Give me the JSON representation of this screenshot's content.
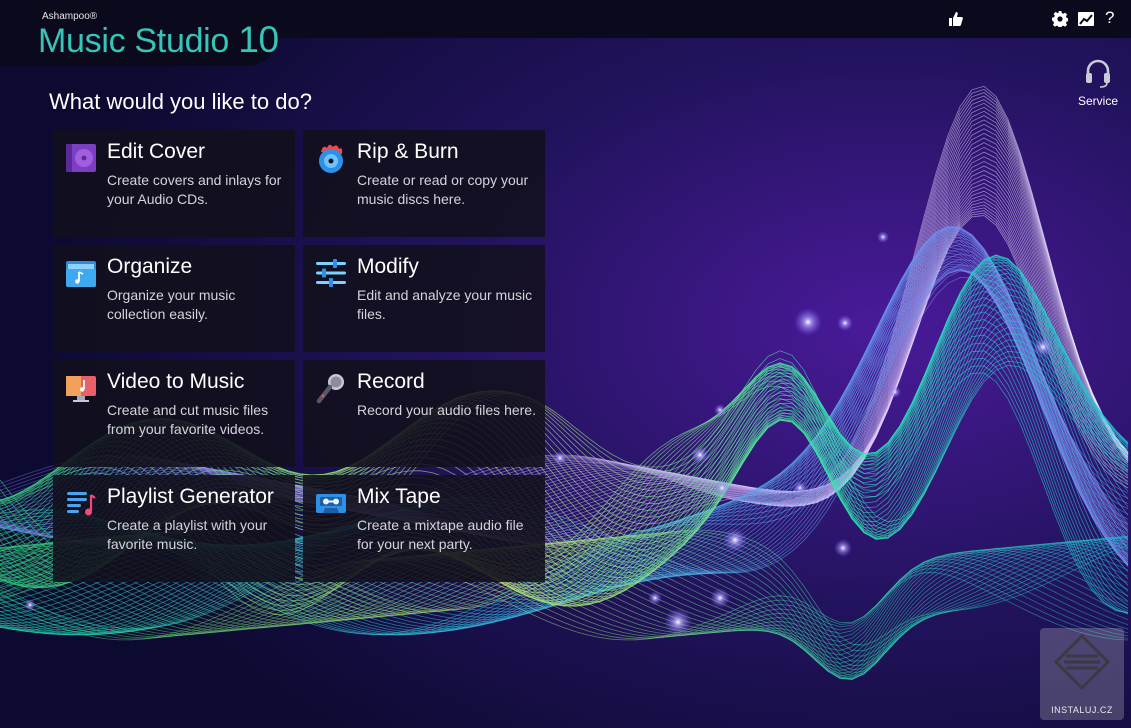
{
  "app": {
    "vendor": "Ashampoo®",
    "name": "Music Studio",
    "version": "10"
  },
  "toolbar": {
    "like_icon": "thumbs-up-icon",
    "settings_icon": "gear-icon",
    "chart_icon": "chart-icon",
    "help_label": "?"
  },
  "service": {
    "label": "Service",
    "icon": "headset-icon"
  },
  "headline": "What would you like to do?",
  "tiles": [
    {
      "title": "Edit Cover",
      "desc": "Create covers and inlays for your Audio CDs.",
      "icon": "disc-case-icon"
    },
    {
      "title": "Rip & Burn",
      "desc": "Create or read or copy your music discs here.",
      "icon": "burning-disc-icon"
    },
    {
      "title": "Organize",
      "desc": "Organize your music collection easily.",
      "icon": "music-folder-icon"
    },
    {
      "title": "Modify",
      "desc": "Edit and analyze your music files.",
      "icon": "sliders-icon"
    },
    {
      "title": "Video to Music",
      "desc": "Create and cut music files from your favorite videos.",
      "icon": "video-monitor-icon"
    },
    {
      "title": "Record",
      "desc": "Record your audio files here.",
      "icon": "microphone-icon"
    },
    {
      "title": "Playlist Generator",
      "desc": "Create a playlist with your favorite music.",
      "icon": "playlist-icon"
    },
    {
      "title": "Mix Tape",
      "desc": "Create a mixtape audio file for your next party.",
      "icon": "cassette-icon"
    }
  ],
  "watermark": "INSTALUJ.CZ",
  "colors": {
    "brand_teal": "#35c6b8",
    "bar_dark": "#0b0a1c",
    "background": "#0d0b35"
  }
}
